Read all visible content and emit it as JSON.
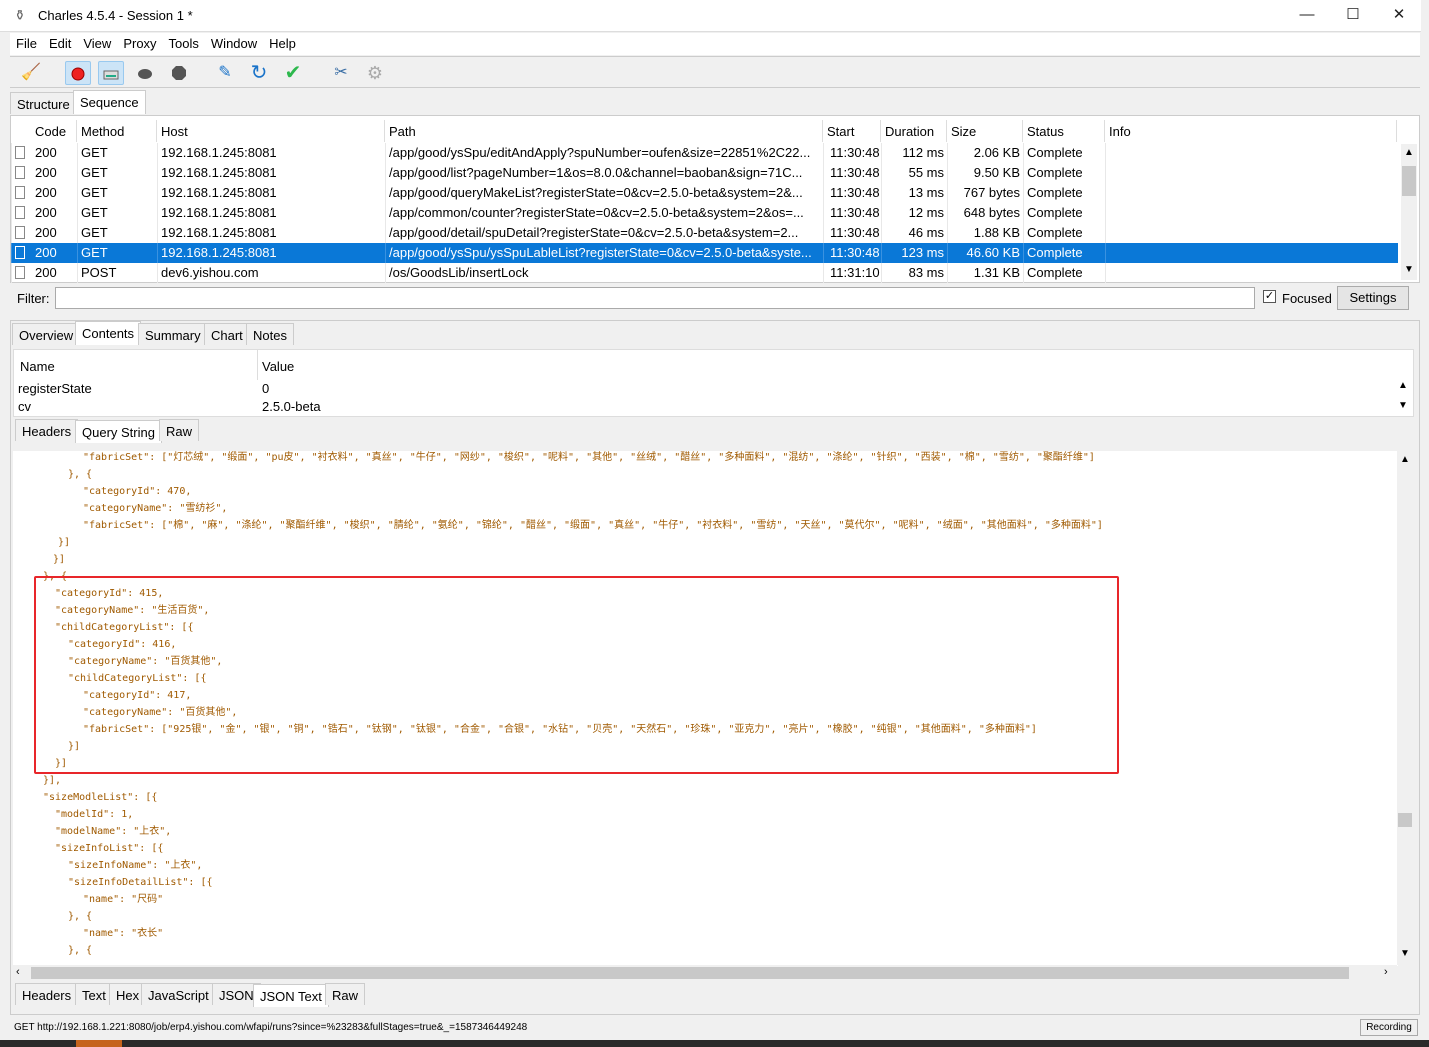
{
  "window": {
    "title": "Charles 4.5.4 - Session 1 *",
    "minimize": "—",
    "maximize": "☐",
    "close": "✕"
  },
  "menu": [
    "File",
    "Edit",
    "View",
    "Proxy",
    "Tools",
    "Window",
    "Help"
  ],
  "top_tabs": [
    "Structure",
    "Sequence"
  ],
  "columns": [
    "Code",
    "Method",
    "Host",
    "Path",
    "Start",
    "Duration",
    "Size",
    "Status",
    "Info"
  ],
  "rows": [
    {
      "code": "200",
      "method": "GET",
      "host": "192.168.1.245:8081",
      "path": "/app/good/ysSpu/editAndApply?spuNumber=oufen&size=22851%2C22...",
      "start": "11:30:48",
      "duration": "112 ms",
      "size": "2.06 KB",
      "status": "Complete"
    },
    {
      "code": "200",
      "method": "GET",
      "host": "192.168.1.245:8081",
      "path": "/app/good/list?pageNumber=1&os=8.0.0&channel=baoban&sign=71C...",
      "start": "11:30:48",
      "duration": "55 ms",
      "size": "9.50 KB",
      "status": "Complete"
    },
    {
      "code": "200",
      "method": "GET",
      "host": "192.168.1.245:8081",
      "path": "/app/good/queryMakeList?registerState=0&cv=2.5.0-beta&system=2&...",
      "start": "11:30:48",
      "duration": "13 ms",
      "size": "767 bytes",
      "status": "Complete"
    },
    {
      "code": "200",
      "method": "GET",
      "host": "192.168.1.245:8081",
      "path": "/app/common/counter?registerState=0&cv=2.5.0-beta&system=2&os=...",
      "start": "11:30:48",
      "duration": "12 ms",
      "size": "648 bytes",
      "status": "Complete"
    },
    {
      "code": "200",
      "method": "GET",
      "host": "192.168.1.245:8081",
      "path": "/app/good/detail/spuDetail?registerState=0&cv=2.5.0-beta&system=2...",
      "start": "11:30:48",
      "duration": "46 ms",
      "size": "1.88 KB",
      "status": "Complete"
    },
    {
      "code": "200",
      "method": "GET",
      "host": "192.168.1.245:8081",
      "path": "/app/good/ysSpu/ysSpuLableList?registerState=0&cv=2.5.0-beta&syste...",
      "start": "11:30:48",
      "duration": "123 ms",
      "size": "46.60 KB",
      "status": "Complete"
    },
    {
      "code": "200",
      "method": "POST",
      "host": "dev6.yishou.com",
      "path": "/os/GoodsLib/insertLock",
      "start": "11:31:10",
      "duration": "83 ms",
      "size": "1.31 KB",
      "status": "Complete"
    }
  ],
  "filter": {
    "label": "Filter:",
    "value": "",
    "focused_label": "Focused",
    "settings_label": "Settings"
  },
  "detail_tabs": [
    "Overview",
    "Contents",
    "Summary",
    "Chart",
    "Notes"
  ],
  "query_table": {
    "headers": [
      "Name",
      "Value"
    ],
    "rows": [
      {
        "name": "registerState",
        "value": "0"
      },
      {
        "name": "cv",
        "value": "2.5.0-beta"
      }
    ]
  },
  "request_tabs": [
    "Headers",
    "Query String",
    "Raw"
  ],
  "response_tabs": [
    "Headers",
    "Text",
    "Hex",
    "JavaScript",
    "JSON",
    "JSON Text",
    "Raw"
  ],
  "json_lines": [
    "\"fabricSet\": [\"灯芯绒\", \"缎面\", \"pu皮\", \"衬衣料\", \"真丝\", \"牛仔\", \"网纱\", \"梭织\", \"呢料\", \"其他\", \"丝绒\", \"醋丝\", \"多种面料\", \"混纺\", \"涤纶\", \"针织\", \"西装\", \"棉\", \"雪纺\", \"聚酯纤维\"]",
    "}, {",
    "\"categoryId\": 470,",
    "\"categoryName\": \"雪纺衫\",",
    "\"fabricSet\": [\"棉\", \"麻\", \"涤纶\", \"聚酯纤维\", \"梭织\", \"腈纶\", \"氨纶\", \"锦纶\", \"醋丝\", \"缎面\", \"真丝\", \"牛仔\", \"衬衣料\", \"雪纺\", \"天丝\", \"莫代尔\", \"呢料\", \"绒面\", \"其他面料\", \"多种面料\"]",
    "}]",
    "}]",
    "}, {",
    "\"categoryId\": 415,",
    "\"categoryName\": \"生活百货\",",
    "\"childCategoryList\": [{",
    "\"categoryId\": 416,",
    "\"categoryName\": \"百货其他\",",
    "\"childCategoryList\": [{",
    "\"categoryId\": 417,",
    "\"categoryName\": \"百货其他\",",
    "\"fabricSet\": [\"925银\", \"金\", \"银\", \"铜\", \"锆石\", \"钛钢\", \"钛银\", \"合金\", \"合银\", \"水钻\", \"贝壳\", \"天然石\", \"珍珠\", \"亚克力\", \"亮片\", \"橡胶\", \"纯银\", \"其他面料\", \"多种面料\"]",
    "}]",
    "}]",
    "}],",
    "\"sizeModleList\": [{",
    "\"modelId\": 1,",
    "\"modelName\": \"上衣\",",
    "\"sizeInfoList\": [{",
    "\"sizeInfoName\": \"上衣\",",
    "\"sizeInfoDetailList\": [{",
    "\"name\": \"尺码\"",
    "}, {",
    "\"name\": \"衣长\"",
    "}, {"
  ],
  "status_url": "GET http://192.168.1.221:8080/job/erp4.yishou.com/wfapi/runs?since=%23283&fullStages=true&_=1587346449248",
  "status_right": "Recording",
  "colors": {
    "selected_row": "#0a78d7",
    "highlight_box": "#e8262a",
    "json_key": "#a0529f",
    "json_string": "#a05a00"
  }
}
